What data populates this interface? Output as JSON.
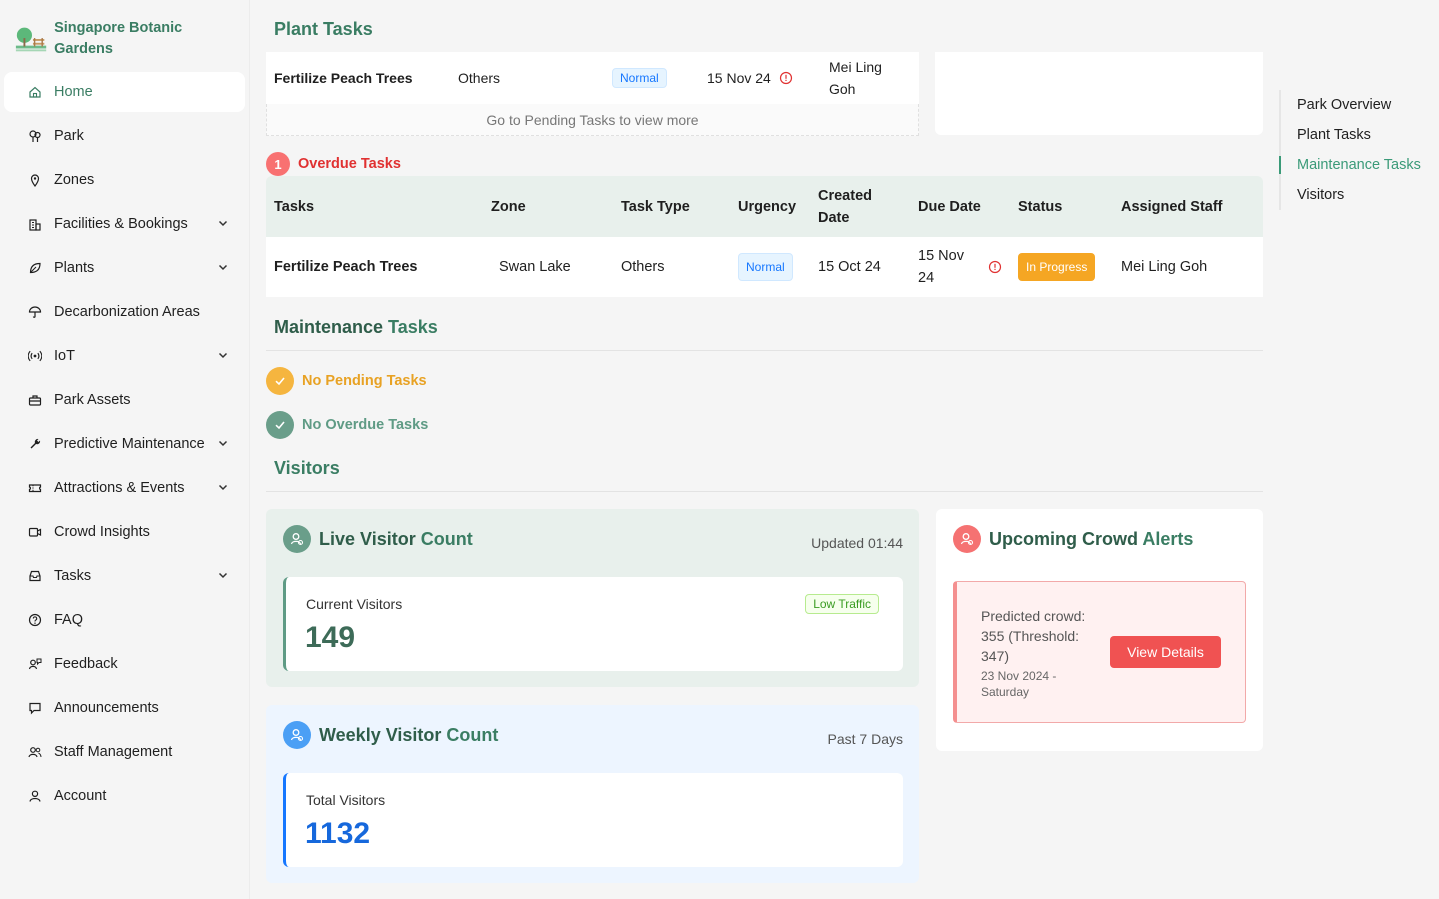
{
  "brand": {
    "name": "Singapore Botanic Gardens"
  },
  "sidebar": {
    "items": [
      {
        "label": "Home",
        "icon": "home-icon",
        "active": true,
        "expandable": false
      },
      {
        "label": "Park",
        "icon": "tree-icon",
        "expandable": false
      },
      {
        "label": "Zones",
        "icon": "pin-icon",
        "expandable": false
      },
      {
        "label": "Facilities & Bookings",
        "icon": "building-icon",
        "expandable": true
      },
      {
        "label": "Plants",
        "icon": "leaf-icon",
        "expandable": true
      },
      {
        "label": "Decarbonization Areas",
        "icon": "umbrella-icon",
        "expandable": false
      },
      {
        "label": "IoT",
        "icon": "broadcast-icon",
        "expandable": true
      },
      {
        "label": "Park Assets",
        "icon": "toolbox-icon",
        "expandable": false
      },
      {
        "label": "Predictive Maintenance",
        "icon": "wrench-icon",
        "expandable": true
      },
      {
        "label": "Attractions & Events",
        "icon": "ticket-icon",
        "expandable": true
      },
      {
        "label": "Crowd Insights",
        "icon": "camera-icon",
        "expandable": false
      },
      {
        "label": "Tasks",
        "icon": "inbox-icon",
        "expandable": true
      },
      {
        "label": "FAQ",
        "icon": "question-icon",
        "expandable": false
      },
      {
        "label": "Feedback",
        "icon": "feedback-icon",
        "expandable": false
      },
      {
        "label": "Announcements",
        "icon": "message-icon",
        "expandable": false
      },
      {
        "label": "Staff Management",
        "icon": "team-icon",
        "expandable": false
      },
      {
        "label": "Account",
        "icon": "user-icon",
        "expandable": false
      }
    ]
  },
  "plant_tasks": {
    "title": "Plant Tasks",
    "pending_row": {
      "task": "Fertilize Peach Trees",
      "type": "Others",
      "urgency": "Normal",
      "due": "15 Nov 24",
      "staff": "Mei Ling Goh"
    },
    "more_text": "Go to Pending Tasks to view more",
    "overdue": {
      "count": "1",
      "label": "Overdue Tasks",
      "headers": [
        "Tasks",
        "Zone",
        "Task Type",
        "Urgency",
        "Created Date",
        "Due Date",
        "Status",
        "Assigned Staff"
      ],
      "rows": [
        {
          "task": "Fertilize Peach Trees",
          "zone": "Swan Lake",
          "type": "Others",
          "urgency": "Normal",
          "created": "15 Oct 24",
          "due": "15 Nov 24",
          "status": "In Progress",
          "staff": "Mei Ling Goh"
        }
      ]
    }
  },
  "maintenance": {
    "title_a": "Maintenance",
    "title_b": " Tasks",
    "pending": "No Pending Tasks",
    "overdue": "No Overdue Tasks"
  },
  "visitors": {
    "title": "Visitors",
    "live": {
      "title_a": "Live Visitor",
      "title_b": " Count",
      "updated": "Updated 01:44",
      "label": "Current Visitors",
      "value": "149",
      "traffic": "Low Traffic"
    },
    "weekly": {
      "title_a": "Weekly Visitor",
      "title_b": " Count",
      "period": "Past 7 Days",
      "label": "Total Visitors",
      "value": "1132"
    },
    "alerts": {
      "title_a": "Upcoming Crowd",
      "title_b": " Alerts",
      "text": "Predicted crowd: 355 (Threshold: 347)",
      "date": "23 Nov 2024 - Saturday",
      "button": "View Details"
    }
  },
  "anchor_nav": {
    "items": [
      "Park Overview",
      "Plant Tasks",
      "Maintenance Tasks",
      "Visitors"
    ],
    "active": "Maintenance Tasks"
  },
  "colors": {
    "accent": "#3a7d63",
    "danger": "#f05252",
    "warning": "#f5a623",
    "blue": "#1677ff"
  }
}
